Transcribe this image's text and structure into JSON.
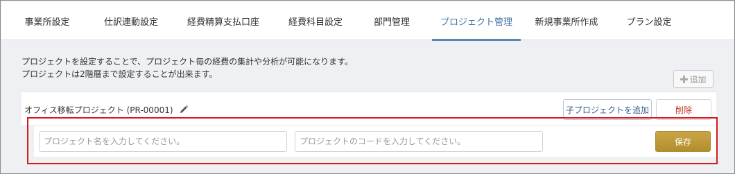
{
  "tabs": [
    {
      "label": "事業所設定",
      "active": false
    },
    {
      "label": "仕訳連動設定",
      "active": false
    },
    {
      "label": "経費精算支払口座",
      "active": false
    },
    {
      "label": "経費科目設定",
      "active": false
    },
    {
      "label": "部門管理",
      "active": false
    },
    {
      "label": "プロジェクト管理",
      "active": true
    },
    {
      "label": "新規事業所作成",
      "active": false
    },
    {
      "label": "プラン設定",
      "active": false
    }
  ],
  "description": {
    "line1": "プロジェクトを設定することで、プロジェクト毎の経費の集計や分析が可能になります。",
    "line2": "プロジェクトは2階層まで設定することが出来ます。"
  },
  "add_button": {
    "label": "追加",
    "icon": "plus-icon"
  },
  "project": {
    "name": "オフィス移転プロジェクト (PR-00001)",
    "edit_icon": "pencil-icon",
    "add_child_label": "子プロジェクトを追加",
    "delete_label": "削除"
  },
  "new_child_form": {
    "name_placeholder": "プロジェクト名を入力してください。",
    "code_placeholder": "プロジェクトのコードを入力してください。",
    "save_label": "保存"
  },
  "colors": {
    "active_tab": "#3f6fa3",
    "delete": "#c0392b",
    "save_button": "#b9952f",
    "highlight": "#d7191c"
  }
}
